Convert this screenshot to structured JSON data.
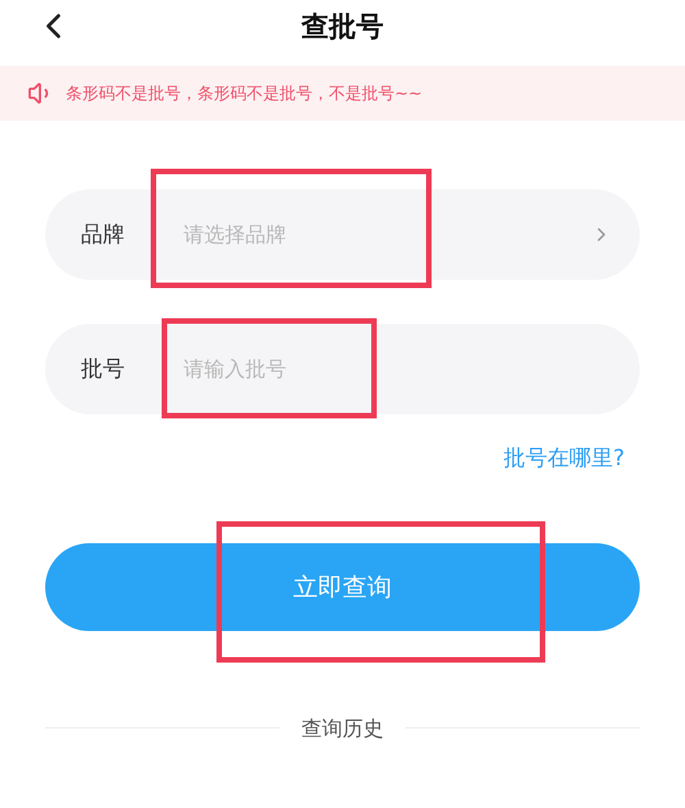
{
  "header": {
    "title": "查批号"
  },
  "notice": {
    "text": "条形码不是批号，条形码不是批号，不是批号~~"
  },
  "fields": [
    {
      "kind": "select",
      "label": "品牌",
      "placeholder": "请选择品牌",
      "highlighted": true
    },
    {
      "kind": "input",
      "label": "批号",
      "placeholder": "请输入批号",
      "highlighted": true
    }
  ],
  "help_link": "批号在哪里?",
  "submit": {
    "label": "立即查询",
    "highlighted": true
  },
  "history": "查询历史"
}
